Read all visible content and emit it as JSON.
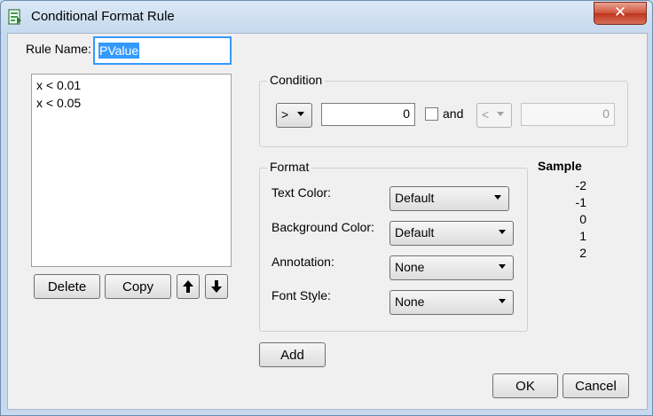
{
  "window": {
    "title": "Conditional Format Rule",
    "close_label": "✕"
  },
  "rule_name": {
    "label": "Rule Name:",
    "value": "PValue"
  },
  "rules": {
    "items": [
      "x < 0.01",
      "x < 0.05"
    ],
    "delete_label": "Delete",
    "copy_label": "Copy"
  },
  "condition": {
    "title": "Condition",
    "operator": ">",
    "value": "0",
    "and_label": "and",
    "operator2": "<",
    "value2": "0"
  },
  "format": {
    "title": "Format",
    "fields": [
      {
        "label": "Text Color:",
        "value": "Default"
      },
      {
        "label": "Background Color:",
        "value": "Default"
      },
      {
        "label": "Annotation:",
        "value": "None"
      },
      {
        "label": "Font Style:",
        "value": "None"
      }
    ]
  },
  "sample": {
    "title": "Sample",
    "values": [
      "-2",
      "-1",
      "0",
      "1",
      "2"
    ]
  },
  "buttons": {
    "add": "Add",
    "ok": "OK",
    "cancel": "Cancel"
  },
  "colors": {
    "selection": "#3399ff",
    "focus_border": "#3399ff",
    "close": "#c7432b"
  }
}
